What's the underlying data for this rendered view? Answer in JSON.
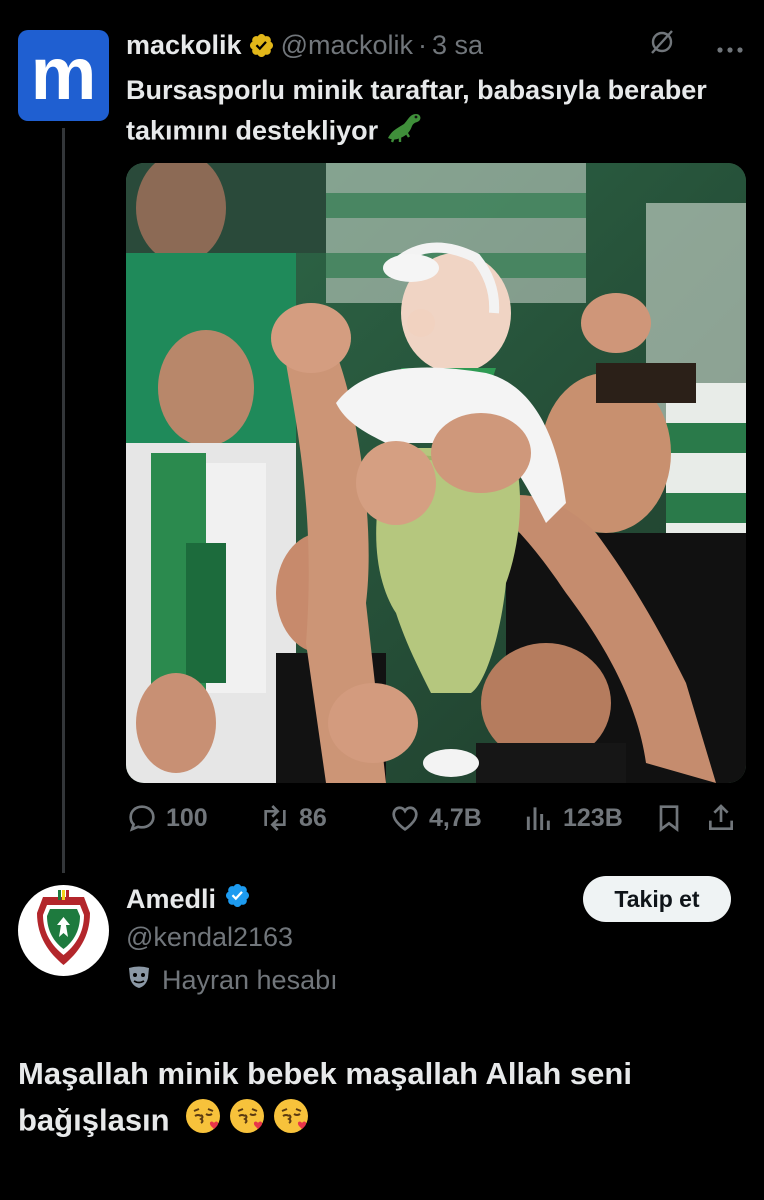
{
  "tweet1": {
    "author_name": "mackolik",
    "handle": "@mackolik",
    "separator": "·",
    "time": "3 sa",
    "text": "Bursasporlu minik taraftar, babasıyla beraber takımını destekliyor",
    "avatar_letter": "m",
    "avatar_color": "#1f5fd1",
    "verified_badge_color": "#e2b719",
    "actions": {
      "replies": "100",
      "retweets": "86",
      "likes": "4,7B",
      "views": "123B"
    },
    "photo_icon": "stadium-fans-baby-photo"
  },
  "tweet2": {
    "author_name": "Amedli",
    "handle": "@kendal2163",
    "fan_label": "Hayran hesabı",
    "follow_label": "Takip et",
    "verified_badge_color": "#1d9bf0",
    "text": "Maşallah minik bebek maşallah Allah seni bağışlasın",
    "emoji": [
      "kissing-face-with-heart",
      "kissing-face-with-heart",
      "kissing-face-with-heart"
    ]
  }
}
